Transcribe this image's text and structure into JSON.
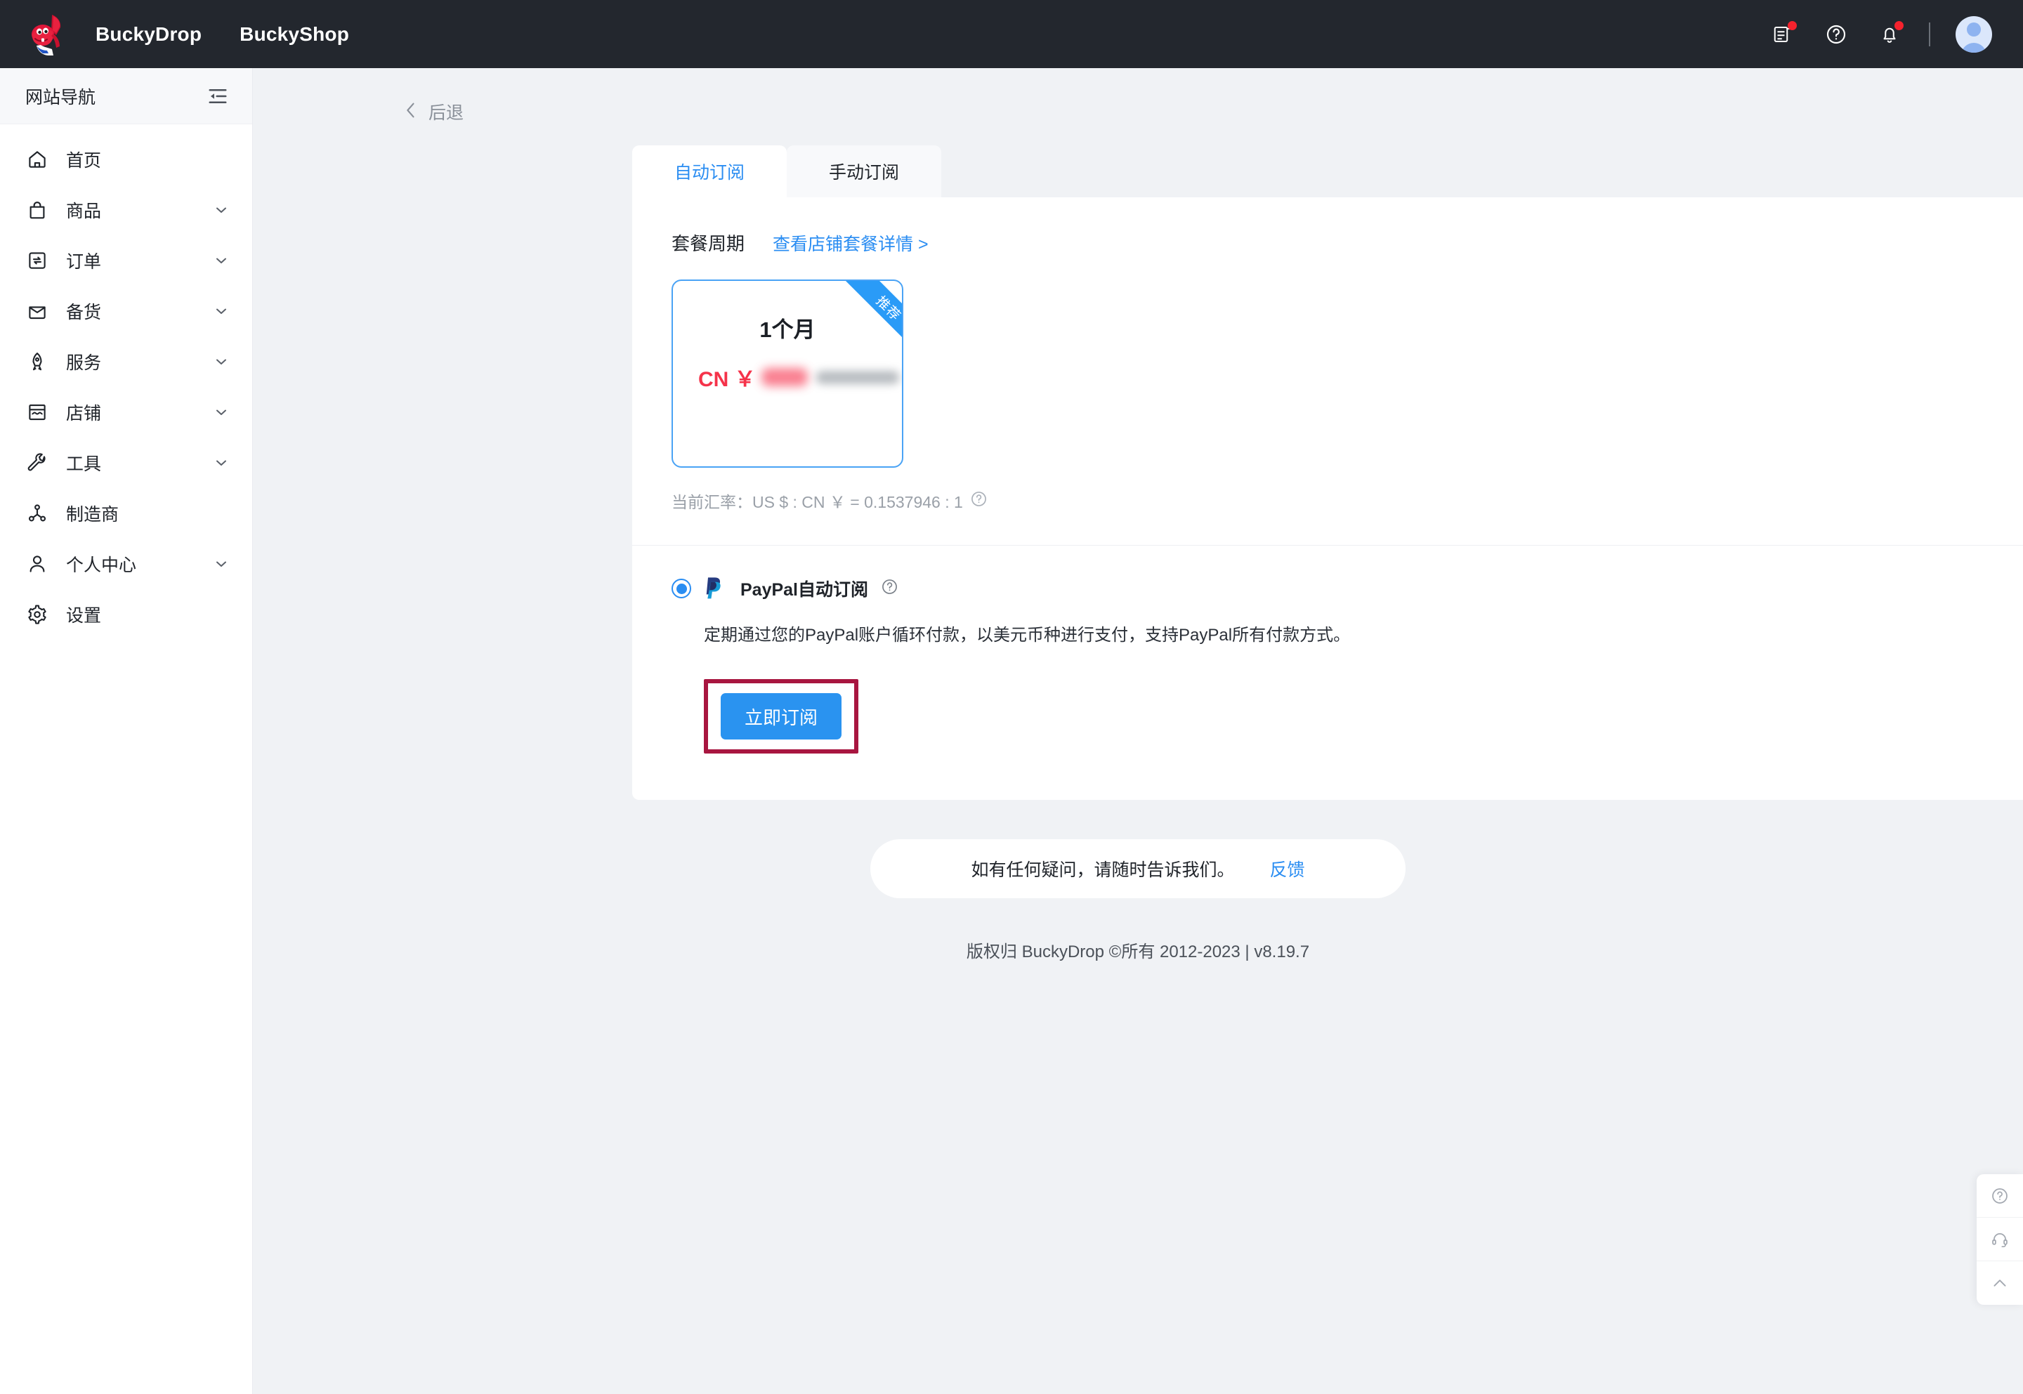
{
  "topbar": {
    "logo_icon": "buckydrop-dino-logo",
    "brand_links": [
      {
        "label": "BuckyDrop",
        "name": "brand-link-buckydrop"
      },
      {
        "label": "BuckyShop",
        "name": "brand-link-buckyshop"
      }
    ],
    "icons": [
      {
        "name": "document-icon",
        "badge": true
      },
      {
        "name": "help-circle-icon",
        "badge": false
      },
      {
        "name": "bell-icon",
        "badge": true
      }
    ],
    "avatar_label": "user-avatar",
    "background_color": "#23272e"
  },
  "sidebar": {
    "title": "网站导航",
    "collapse_icon": "collapse-menu-icon",
    "items": [
      {
        "label": "首页",
        "icon": "home-icon",
        "expandable": false
      },
      {
        "label": "商品",
        "icon": "bag-icon",
        "expandable": true
      },
      {
        "label": "订单",
        "icon": "order-sync-icon",
        "expandable": true
      },
      {
        "label": "备货",
        "icon": "inbox-icon",
        "expandable": true
      },
      {
        "label": "服务",
        "icon": "rocket-icon",
        "expandable": true
      },
      {
        "label": "店铺",
        "icon": "storefront-icon",
        "expandable": true
      },
      {
        "label": "工具",
        "icon": "wrench-icon",
        "expandable": true
      },
      {
        "label": "制造商",
        "icon": "network-nodes-icon",
        "expandable": false
      },
      {
        "label": "个人中心",
        "icon": "user-icon",
        "expandable": true
      },
      {
        "label": "设置",
        "icon": "gear-icon",
        "expandable": false
      }
    ]
  },
  "main": {
    "back_label": "后退",
    "back_icon": "chevron-left-icon",
    "tabs": [
      {
        "label": "自动订阅",
        "active": true
      },
      {
        "label": "手动订阅",
        "active": false
      }
    ],
    "plan_section": {
      "title": "套餐周期",
      "link": "查看店铺套餐详情 >",
      "cards": [
        {
          "period": "1个月",
          "currency": "CN ￥",
          "price_masked": true,
          "ribbon": "推荐",
          "selected": true
        }
      ],
      "rate_text": "当前汇率：US $ : CN ￥ = 0.1537946 : 1",
      "rate_help_icon": "question-circle-icon"
    },
    "payment": {
      "method_name": "PayPal自动订阅",
      "method_logo": "paypal-logo",
      "help_icon": "question-circle-icon",
      "selected": true,
      "description": "定期通过您的PayPal账户循环付款，以美元币种进行支付，支持PayPal所有付款方式。"
    },
    "subscribe_button": "立即订阅",
    "feedback": {
      "text": "如有任何疑问，请随时告诉我们。",
      "link": "反馈"
    },
    "copyright": "版权归 BuckyDrop ©所有 2012-2023 | v8.19.7"
  },
  "float_widget": {
    "items": [
      {
        "name": "help-circle-icon"
      },
      {
        "name": "headset-icon"
      },
      {
        "name": "scroll-to-top-icon"
      }
    ]
  },
  "colors": {
    "accent": "#2a8df2",
    "button": "#2a93f0",
    "ribbon": "#2a9bf7",
    "price_red": "#f5334a",
    "highlight_border": "#a81640",
    "topbar_bg": "#23272e",
    "page_bg": "#f0f2f5"
  }
}
